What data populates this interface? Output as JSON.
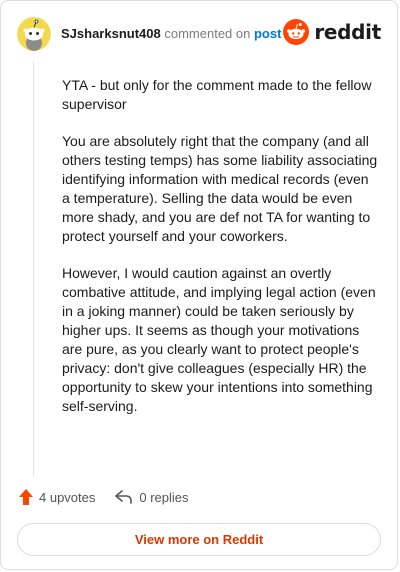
{
  "header": {
    "username": "SJsharksnut408",
    "action_text": "commented on",
    "post_link": "post",
    "brand": "reddit"
  },
  "comment": {
    "paragraphs": [
      "YTA - but only for the comment made to the fellow supervisor",
      "You are absolutely right that the company (and all others testing temps) has some liability associating identifying information with medical records (even a temperature). Selling the data would be even more shady, and you are def not TA for wanting to protect yourself and your coworkers.",
      "However, I would caution against an overtly combative attitude, and implying legal action (even in a joking manner) could be taken seriously by higher ups. It seems as though your motivations are pure, as you clearly want to protect people's privacy: don't give colleagues (especially HR) the opportunity to skew your intentions into something self-serving."
    ]
  },
  "footer": {
    "upvotes": "4 upvotes",
    "replies": "0 replies",
    "view_more": "View more on Reddit"
  },
  "colors": {
    "accent": "#ff4500",
    "link": "#0079d3",
    "view_more": "#d93900"
  },
  "icons": {
    "avatar": "snoo-avatar",
    "brand": "reddit-logo-icon",
    "upvote": "upvote-arrow-icon",
    "reply": "reply-arrow-icon"
  }
}
